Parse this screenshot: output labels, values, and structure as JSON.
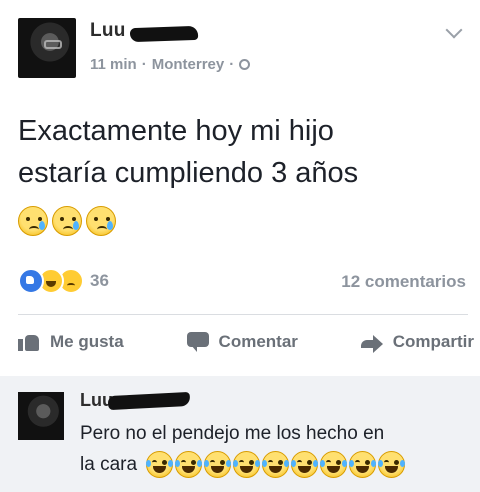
{
  "post": {
    "author": "Luu",
    "time": "11 min",
    "separator": "·",
    "location": "Monterrey",
    "text_line1": "Exactamente hoy mi hijo",
    "text_line2": "estaría cumpliendo 3 años",
    "reaction_count": "36",
    "comments_count": "12 comentarios"
  },
  "actions": {
    "like": "Me gusta",
    "comment": "Comentar",
    "share": "Compartir"
  },
  "comment": {
    "author": "Luu",
    "text_line1": "Pero no el pendejo me los hecho en",
    "text_line2": "la cara"
  },
  "icons": {
    "post_emojis": [
      "crying-face-icon",
      "crying-face-icon",
      "crying-face-icon"
    ],
    "comment_emojis": [
      "laughing-tears-icon",
      "laughing-tears-icon",
      "laughing-tears-icon",
      "laughing-tears-icon",
      "laughing-tears-icon",
      "laughing-tears-icon",
      "laughing-tears-icon",
      "laughing-tears-icon",
      "laughing-tears-icon"
    ]
  },
  "colors": {
    "link_blue": "#3578e5",
    "muted": "#8d949e",
    "comment_bg": "#f0f2f5"
  }
}
